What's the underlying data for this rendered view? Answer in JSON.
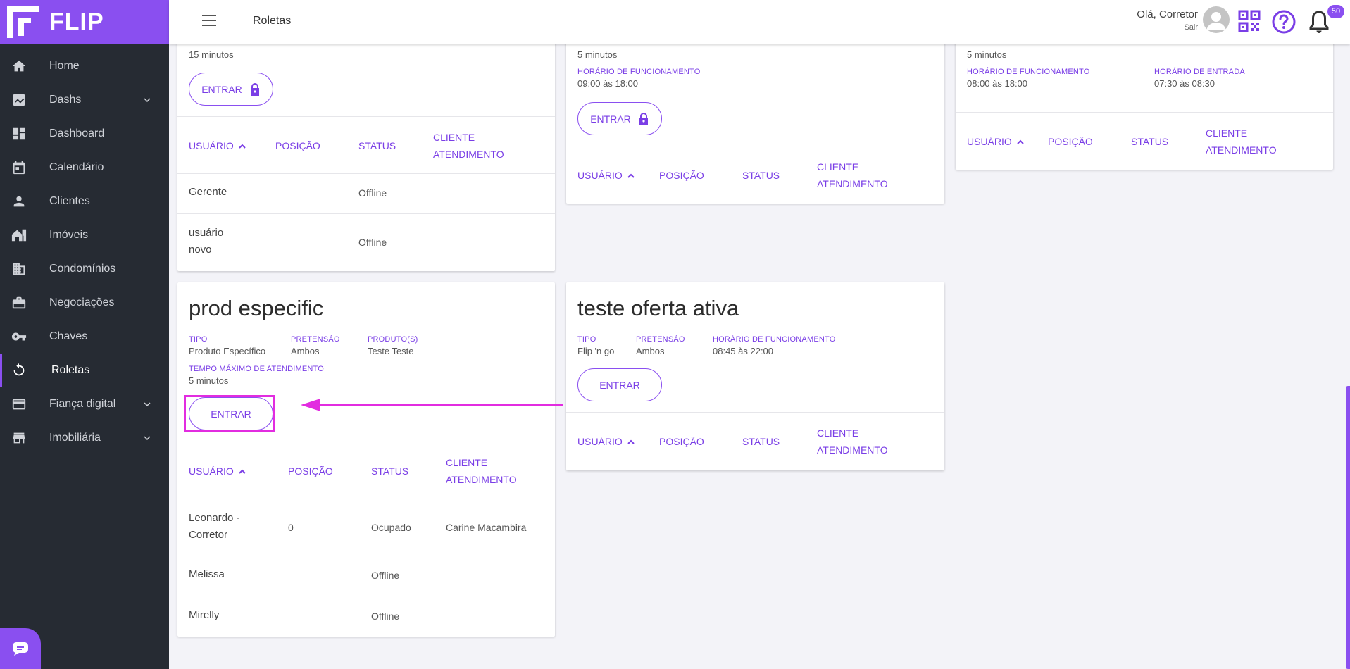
{
  "app": {
    "logo_text": "FLIP",
    "accent": "#8a4ff0"
  },
  "sidebar": {
    "items": [
      {
        "label": "Home",
        "icon": "home-icon"
      },
      {
        "label": "Dashs",
        "icon": "chart-icon",
        "expandable": true
      },
      {
        "label": "Dashboard",
        "icon": "dashboard-icon"
      },
      {
        "label": "Calendário",
        "icon": "calendar-icon"
      },
      {
        "label": "Clientes",
        "icon": "person-icon"
      },
      {
        "label": "Imóveis",
        "icon": "house-icon"
      },
      {
        "label": "Condomínios",
        "icon": "building-icon"
      },
      {
        "label": "Negociações",
        "icon": "briefcase-icon"
      },
      {
        "label": "Chaves",
        "icon": "key-icon"
      },
      {
        "label": "Roletas",
        "icon": "roulette-icon",
        "active": true
      },
      {
        "label": "Fiança digital",
        "icon": "card-icon",
        "expandable": true
      },
      {
        "label": "Imobiliária",
        "icon": "store-icon",
        "expandable": true
      }
    ]
  },
  "header": {
    "title": "Roletas",
    "greeting": "Olá, Corretor",
    "logout": "Sair",
    "notifications_count": "50"
  },
  "table_headers": {
    "user": "USUÁRIO",
    "position": "POSIÇÃO",
    "status": "STATUS",
    "client_l1": "CLIENTE",
    "client_l2": "ATENDIMENTO"
  },
  "enter_label": "ENTRAR",
  "card1": {
    "time_value": "15 minutos",
    "rows": [
      {
        "user": "Gerente",
        "status": "Offline"
      },
      {
        "user_l1": "usuário",
        "user_l2": "novo",
        "status": "Offline"
      }
    ]
  },
  "card2": {
    "time_value": "5 minutos",
    "hours_label": "HORÁRIO DE FUNCIONAMENTO",
    "hours_value": "09:00 às 18:00"
  },
  "card3": {
    "time_value": "5 minutos",
    "hours_label": "HORÁRIO DE FUNCIONAMENTO",
    "hours_value": "08:00 às 18:00",
    "entry_label": "HORÁRIO DE ENTRADA",
    "entry_value": "07:30 às 08:30"
  },
  "card4": {
    "title": "prod especific",
    "type_label": "TIPO",
    "type_value": "Produto Específico",
    "intent_label": "PRETENSÃO",
    "intent_value": "Ambos",
    "product_label": "PRODUTO(S)",
    "product_value": "Teste Teste",
    "max_time_label": "TEMPO MÁXIMO DE ATENDIMENTO",
    "max_time_value": "5 minutos",
    "rows": [
      {
        "user_l1": "Leonardo -",
        "user_l2": "Corretor",
        "position": "0",
        "status": "Ocupado",
        "client": "Carine Macambira"
      },
      {
        "user": "Melissa",
        "status": "Offline"
      },
      {
        "user": "Mirelly",
        "status": "Offline"
      }
    ]
  },
  "card5": {
    "title": "teste oferta ativa",
    "type_label": "TIPO",
    "type_value": "Flip 'n go",
    "intent_label": "PRETENSÃO",
    "intent_value": "Ambos",
    "hours_label": "HORÁRIO DE FUNCIONAMENTO",
    "hours_value": "08:45 às 22:00"
  }
}
